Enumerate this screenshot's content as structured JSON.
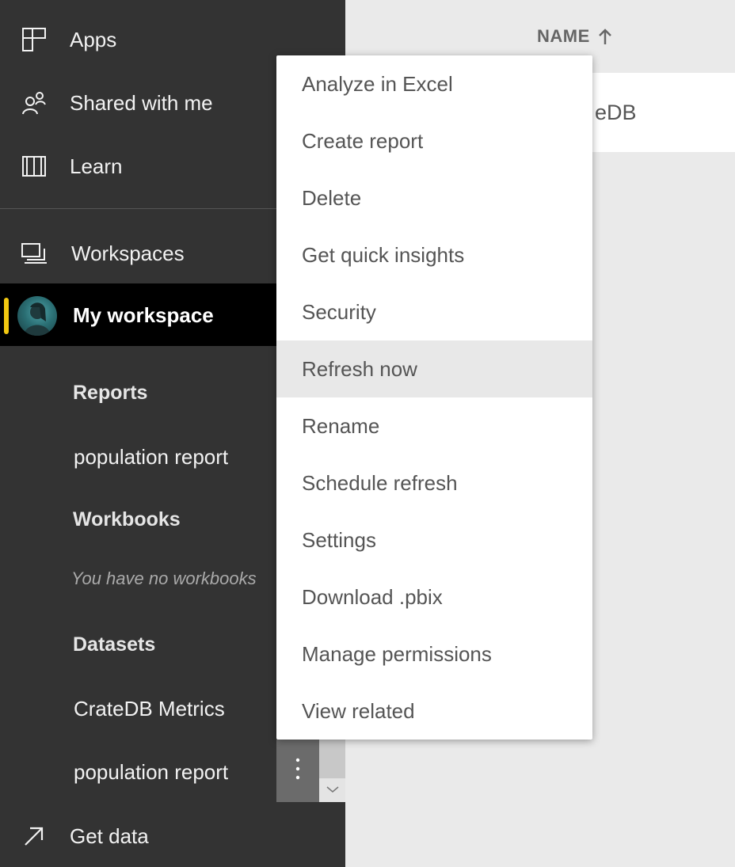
{
  "sidebar": {
    "nav": [
      {
        "label": "Apps",
        "icon": "apps-icon"
      },
      {
        "label": "Shared with me",
        "icon": "shared-with-me-icon"
      },
      {
        "label": "Learn",
        "icon": "learn-book-icon"
      },
      {
        "label": "Workspaces",
        "icon": "workspaces-icon"
      }
    ],
    "workspace": {
      "label": "My workspace",
      "accent_color": "#f2c811"
    },
    "sections": {
      "reports": {
        "header": "Reports",
        "items": [
          "population report"
        ]
      },
      "workbooks": {
        "header": "Workbooks",
        "empty_text": "You have no workbooks"
      },
      "datasets": {
        "header": "Datasets",
        "items": [
          "CrateDB Metrics",
          "population report"
        ]
      }
    },
    "get_data": {
      "label": "Get data",
      "icon": "get-data-arrow-icon"
    }
  },
  "main": {
    "column_header": "NAME",
    "sort_icon": "sort-ascending-arrow-icon",
    "row_partial_text": "eDB"
  },
  "context_menu": {
    "items": [
      "Analyze in Excel",
      "Create report",
      "Delete",
      "Get quick insights",
      "Security",
      "Refresh now",
      "Rename",
      "Schedule refresh",
      "Settings",
      "Download .pbix",
      "Manage permissions",
      "View related"
    ],
    "highlighted": "Refresh now"
  }
}
